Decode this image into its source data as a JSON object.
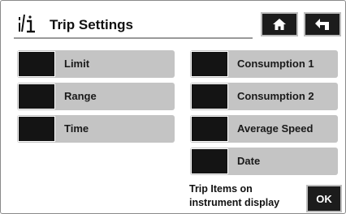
{
  "header": {
    "title": "Trip Settings",
    "icon": "trip-info-icon"
  },
  "nav": {
    "home_icon": "home-icon",
    "back_icon": "back-arrow-icon"
  },
  "left_items": [
    {
      "label": "Limit"
    },
    {
      "label": "Range"
    },
    {
      "label": "Time"
    }
  ],
  "right_items": [
    {
      "label": "Consumption 1"
    },
    {
      "label": "Consumption 2"
    },
    {
      "label": "Average Speed"
    },
    {
      "label": "Date"
    }
  ],
  "footer": {
    "note_line1": "Trip Items on",
    "note_line2": "instrument display",
    "ok_label": "OK"
  },
  "colors": {
    "item_background": "#c4c4c4",
    "swatch": "#141414",
    "button": "#1c1c1c"
  }
}
